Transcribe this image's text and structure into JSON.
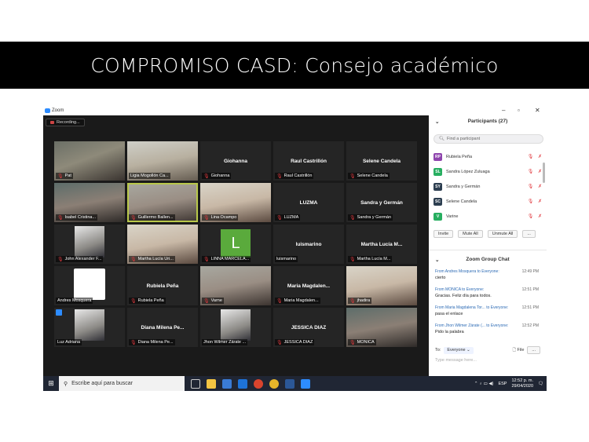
{
  "slide_title": "COMPROMISO CASD: Consejo académico",
  "window": {
    "title": "Zoom",
    "controls": [
      "–",
      "▫",
      "✕"
    ]
  },
  "recording_label": "Recording...",
  "tiles": [
    {
      "name": "Pat",
      "kind": "photo",
      "style": "p1",
      "muted": true
    },
    {
      "name": "Ligia Mogollón Ca...",
      "kind": "photo",
      "style": "p2",
      "muted": false
    },
    {
      "name": "Giohanna",
      "kind": "text",
      "muted": true
    },
    {
      "name": "Raul Castrillón",
      "kind": "text",
      "muted": true
    },
    {
      "name": "Selene Candela",
      "kind": "text",
      "muted": true
    },
    {
      "name": "Isabel Cristina...",
      "kind": "photo",
      "style": "p5",
      "muted": true
    },
    {
      "name": "Guillermo Ballen...",
      "kind": "photo",
      "style": "p4",
      "muted": true,
      "active": true
    },
    {
      "name": "Lina Ocampo",
      "kind": "photo",
      "style": "p3",
      "muted": true
    },
    {
      "name": "LUZMA",
      "kind": "text",
      "muted": true
    },
    {
      "name": "Sandra y Germán",
      "kind": "text",
      "muted": true
    },
    {
      "name": "John Alexander F...",
      "kind": "square",
      "muted": true
    },
    {
      "name": "Martha Lucía Uri...",
      "kind": "photo",
      "style": "p3",
      "muted": true
    },
    {
      "name": "LINNA MARCELA...",
      "kind": "letter",
      "letter": "L",
      "muted": true
    },
    {
      "name": "luismarino",
      "kind": "text",
      "muted": false
    },
    {
      "name": "Martha Lucía M...",
      "kind": "text",
      "muted": true
    },
    {
      "name": "Andres Mosquera",
      "kind": "abc",
      "muted": false
    },
    {
      "name": "Rubiela Peña",
      "kind": "text",
      "muted": true
    },
    {
      "name": "Varne",
      "kind": "photo",
      "style": "p4",
      "muted": true
    },
    {
      "name": "Maria Magdalen...",
      "kind": "text",
      "muted": true
    },
    {
      "name": "jhadira",
      "kind": "photo",
      "style": "p3",
      "muted": true
    },
    {
      "name": "Luz Adriana",
      "kind": "square",
      "muted": false,
      "badge": true
    },
    {
      "name": "Diana Milena Pe...",
      "kind": "text",
      "muted": true
    },
    {
      "name": "Jhon Wilmer Zárate ...",
      "kind": "square",
      "muted": false
    },
    {
      "name": "JESSICA DIAZ",
      "kind": "text",
      "muted": true
    },
    {
      "name": "MONICA",
      "kind": "photo",
      "style": "p5",
      "muted": true
    }
  ],
  "taskbar": {
    "search_placeholder": "Escribe aquí para buscar",
    "lang": "ESP",
    "time": "12:52 p. m.",
    "date": "29/04/2020"
  },
  "participants": {
    "header": "Participants (27)",
    "search_placeholder": "Find a participant",
    "list": [
      {
        "initials": "RP",
        "name": "Rubiela Peña",
        "color": "#8e44ad"
      },
      {
        "initials": "SL",
        "name": "Sandra López Zuluaga",
        "color": "#27ae60"
      },
      {
        "initials": "SY",
        "name": "Sandra y Germán",
        "color": "#2c3e50"
      },
      {
        "initials": "SC",
        "name": "Selene Candela",
        "color": "#2c3e50"
      },
      {
        "initials": "V",
        "name": "Varine",
        "color": "#27ae60"
      }
    ],
    "buttons": [
      "Invite",
      "Mute All",
      "Unmute All",
      "..."
    ]
  },
  "chat": {
    "header": "Zoom Group Chat",
    "messages": [
      {
        "from": "From Andres Mosquera to Everyone:",
        "time": "12:49 PM",
        "text": "cierto"
      },
      {
        "from": "From MONICA to Everyone:",
        "time": "12:51 PM",
        "text": "Gracias. Feliz día para todos."
      },
      {
        "from": "From Maria Magdalena Tor... to Everyone:",
        "time": "12:51 PM",
        "text": "pasa el enlace"
      },
      {
        "from": "From Jhon Wilmer Zárate (... to Everyone:",
        "time": "12:52 PM",
        "text": "Pido la palabra"
      }
    ],
    "to_label": "To:",
    "to_value": "Everyone",
    "file_label": "File",
    "more_label": "...",
    "type_placeholder": "Type message here..."
  }
}
